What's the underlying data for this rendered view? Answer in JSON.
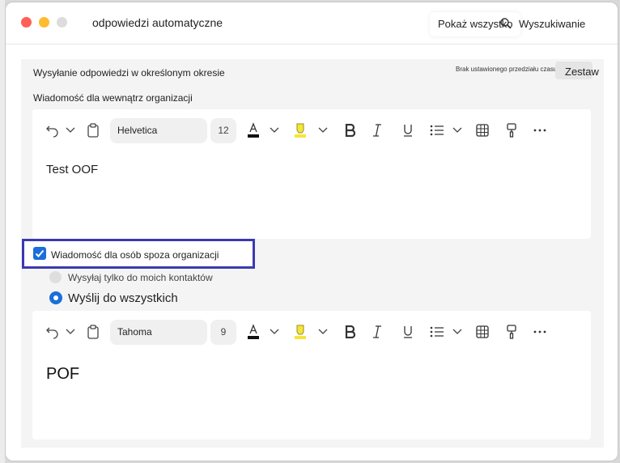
{
  "window": {
    "title": "odpowiedzi automatyczne",
    "show_all": "Pokaż wszystko",
    "search_label": "Wyszukiwanie"
  },
  "period": {
    "label": "Wysyłanie odpowiedzi w określonym okresie",
    "no_range": "Brak ustawionego przedziału czasu",
    "set_button": "Zestaw"
  },
  "inside": {
    "label": "Wiadomość dla wewnątrz organizacji",
    "font": "Helvetica",
    "size": "12",
    "content": "Test OOF"
  },
  "outside": {
    "checkbox_label": "Wiadomość dla osób spoza organizacji",
    "checked": true,
    "option_contacts": "Wysyłaj tylko do moich kontaktów",
    "option_all": "Wyślij do wszystkich",
    "selected": "option_all",
    "font": "Tahoma",
    "size": "9",
    "content": "POF"
  },
  "colors": {
    "accent": "#1a6fd8",
    "highlight_border": "#3b3ab0",
    "highlighter": "#f5e53b"
  }
}
